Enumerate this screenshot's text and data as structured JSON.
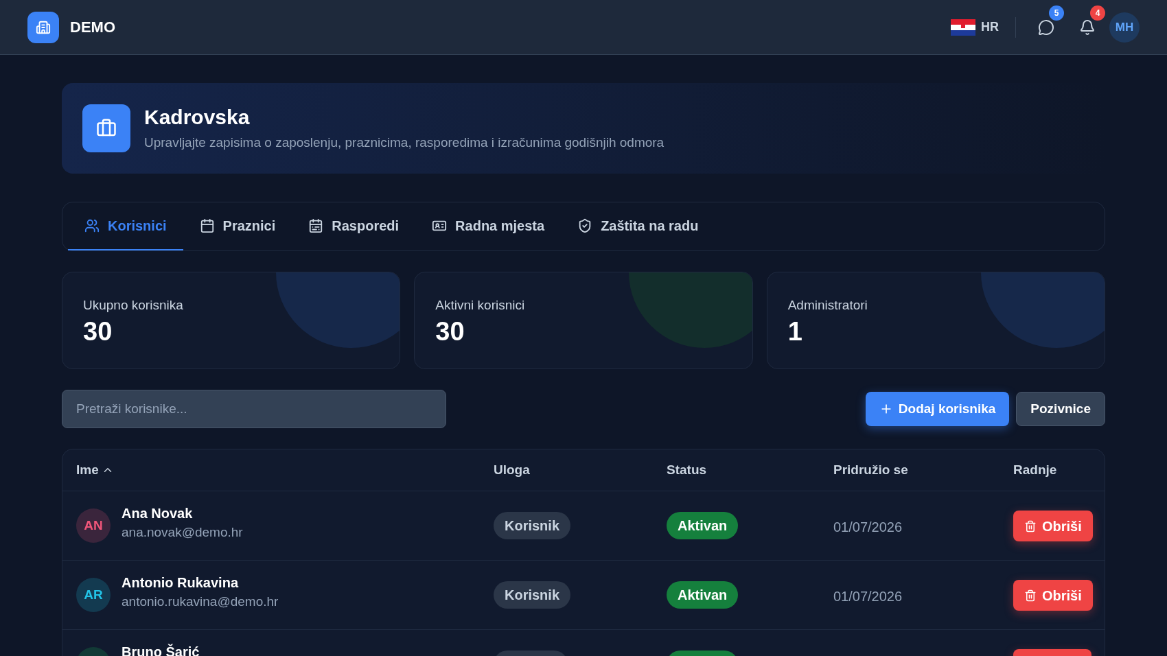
{
  "topbar": {
    "brand": "DEMO",
    "language": "HR",
    "messages_badge": "5",
    "notifications_badge": "4",
    "user_initials": "MH"
  },
  "header": {
    "title": "Kadrovska",
    "subtitle": "Upravljajte zapisima o zaposlenju, praznicima, rasporedima i izračunima godišnjih odmora"
  },
  "tabs": [
    {
      "label": "Korisnici",
      "kind": "users",
      "selected": true
    },
    {
      "label": "Praznici",
      "kind": "calendar",
      "selected": false
    },
    {
      "label": "Rasporedi",
      "kind": "schedule",
      "selected": false
    },
    {
      "label": "Radna mjesta",
      "kind": "card",
      "selected": false
    },
    {
      "label": "Zaštita na radu",
      "kind": "shield",
      "selected": false
    }
  ],
  "stats": [
    {
      "label": "Ukupno korisnika",
      "value": "30",
      "color": "#16284a"
    },
    {
      "label": "Aktivni korisnici",
      "value": "30",
      "color": "#132e2c"
    },
    {
      "label": "Administratori",
      "value": "1",
      "color": "#16284a"
    }
  ],
  "search": {
    "placeholder": "Pretraži korisnike..."
  },
  "actions": {
    "add": "Dodaj korisnika",
    "invites": "Pozivnice"
  },
  "table": {
    "columns": [
      "Ime",
      "Uloga",
      "Status",
      "Pridružio se",
      "Radnje"
    ],
    "rows": [
      {
        "initials": "AN",
        "color": "#f0567a",
        "name": "Ana Novak",
        "email": "ana.novak@demo.hr",
        "role": "Korisnik",
        "status": "Aktivan",
        "joined": "01/07/2026",
        "action": "Obriši"
      },
      {
        "initials": "AR",
        "color": "#22c3e6",
        "name": "Antonio Rukavina",
        "email": "antonio.rukavina@demo.hr",
        "role": "Korisnik",
        "status": "Aktivan",
        "joined": "01/07/2026",
        "action": "Obriši"
      },
      {
        "color": "#123a36",
        "name": "Bruno Šarić"
      }
    ]
  }
}
